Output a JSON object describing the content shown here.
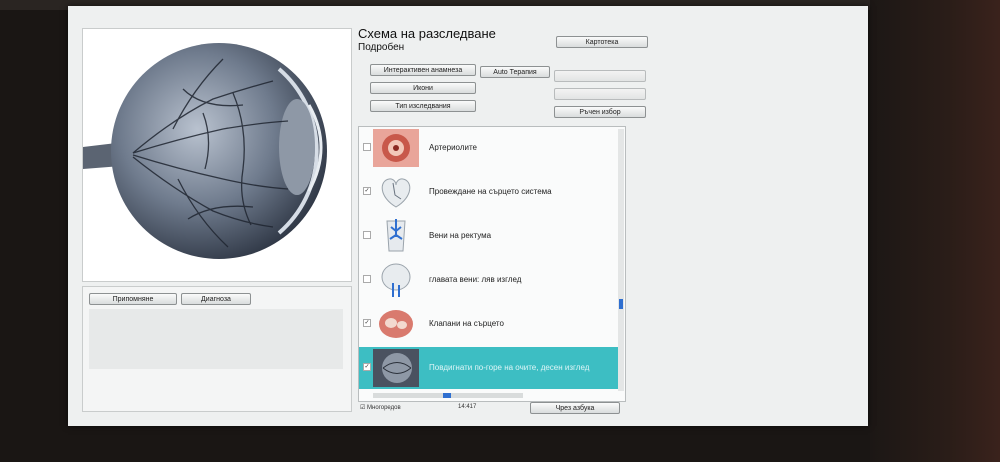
{
  "left": {
    "buttons": {
      "reminder": "Припомняне",
      "diagnosis": "Диагноза"
    }
  },
  "header": {
    "title": "Схема на разследване",
    "subtitle": "Подробен"
  },
  "toolbar": {
    "catalog": "Картотека",
    "interactive": "Интерактивен анамнеза",
    "auto_therapy": "Auto Терапия",
    "icons": "Икони",
    "study_type": "Тип изследвания",
    "manual_select": "Ръчен избор"
  },
  "list": {
    "items": [
      {
        "label": "Артериолите",
        "checked": false
      },
      {
        "label": "Провеждане на сърцето система",
        "checked": true
      },
      {
        "label": "Вени на ректума",
        "checked": false
      },
      {
        "label": "главата вени: ляв изглед",
        "checked": false
      },
      {
        "label": "Клапани на сърцето",
        "checked": true
      },
      {
        "label": "Повдигнати по-горе на очите, десен изглед",
        "checked": true
      }
    ],
    "selected_index": 5
  },
  "footer": {
    "multi_select": "Многоредов",
    "counter": "14:417",
    "alphabet_button": "Чрез азбука"
  },
  "colors": {
    "selection": "#3dbec3",
    "scroll": "#2f6fd0"
  }
}
